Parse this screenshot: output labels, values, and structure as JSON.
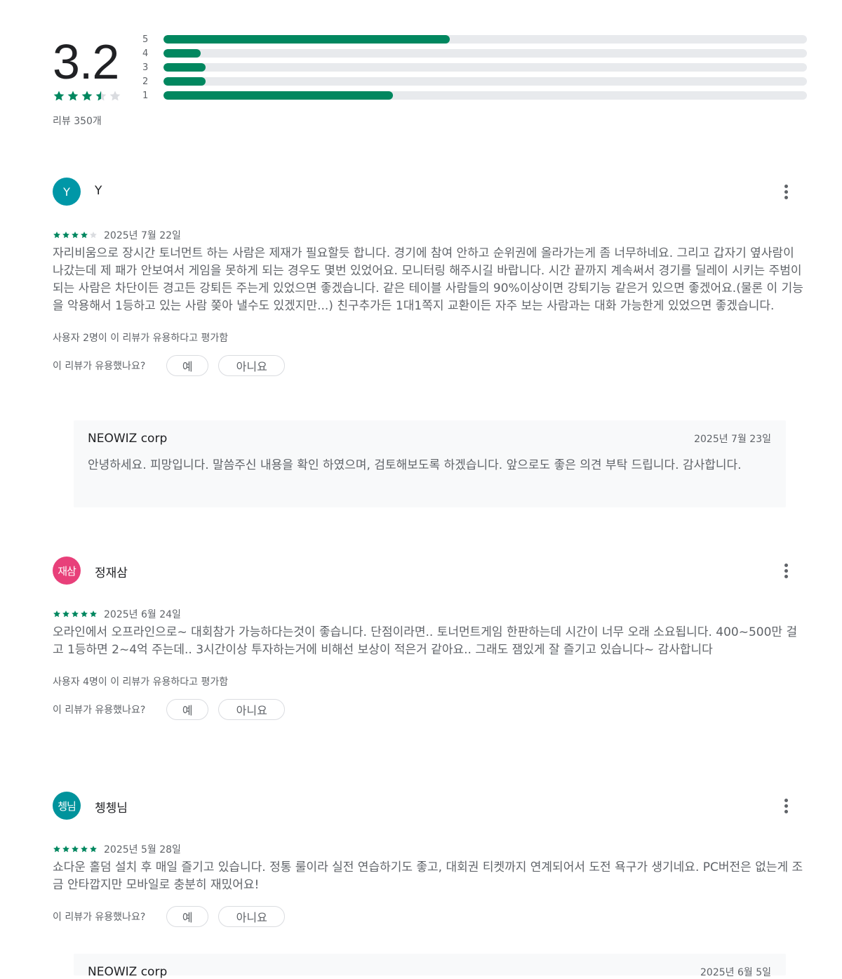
{
  "summary": {
    "score": "3.2",
    "rating": 3.5,
    "review_count": "리뷰 350개",
    "bars": [
      {
        "label": "5",
        "fraction": 0.445
      },
      {
        "label": "4",
        "fraction": 0.058
      },
      {
        "label": "3",
        "fraction": 0.065
      },
      {
        "label": "2",
        "fraction": 0.065
      },
      {
        "label": "1",
        "fraction": 0.357
      }
    ]
  },
  "colors": {
    "star_filled": "#01875f",
    "star_empty": "#dadce0",
    "bar_fill": "#01875f",
    "bar_track": "#e8eaed"
  },
  "helpful_question": "이 리뷰가 유용했나요?",
  "yes_label": "예",
  "no_label": "아니요",
  "reviews": [
    {
      "avatar_text": "Y",
      "avatar_color": "#0097a7",
      "author": "Y",
      "rating": 4,
      "date": "2025년 7월 22일",
      "text": "자리비움으로 장시간 토너먼트 하는 사람은 제재가 필요할듯 합니다. 경기에 참여 안하고 순위권에 올라가는게 좀 너무하네요. 그리고 갑자기 옆사람이 나갔는데 제 패가 안보여서 게임을 못하게 되는 경우도 몇번 있었어요. 모니터링 해주시길 바랍니다. 시간 끝까지 계속써서 경기를 딜레이 시키는 주범이 되는 사람은 차단이든 경고든 강퇴든 주는게 있었으면 좋겠습니다. 같은 테이블 사람들의 90%이상이면 강퇴기능 같은거 있으면 좋겠어요.(물론 이 기능을 악용해서 1등하고 있는 사람 쫒아 낼수도 있겠지만...) 친구추가든 1대1쪽지 교환이든 자주 보는 사람과는 대화 가능한게 있었으면 좋겠습니다.",
      "helpful_count": "사용자 2명이 이 리뷰가 유용하다고 평가함",
      "reply": {
        "name": "NEOWIZ corp",
        "date": "2025년 7월 23일",
        "text": "안녕하세요. 피망입니다. 말씀주신 내용을 확인 하였으며, 검토해보도록 하겠습니다. 앞으로도 좋은 의견 부탁 드립니다. 감사합니다."
      }
    },
    {
      "avatar_text": "재삼",
      "avatar_color": "#e8407a",
      "author": "정재삼",
      "rating": 5,
      "date": "2025년 6월 24일",
      "text": "오라인에서 오프라인으로~ 대회참가 가능하다는것이 좋습니다. 단점이라면.. 토너먼트게임 한판하는데 시간이 너무 오래 소요됩니다. 400~500만 걸고 1등하면 2~4억 주는데.. 3시간이상 투자하는거에 비해선 보상이 적은거 같아요.. 그래도 잼있게 잘 즐기고 있습니다~ 감사합니다",
      "helpful_count": "사용자 4명이 이 리뷰가 유용하다고 평가함"
    },
    {
      "avatar_text": "쳉님",
      "avatar_color": "#00939c",
      "author": "쳉쳉님",
      "rating": 5,
      "date": "2025년 5월 28일",
      "text": "쇼다운 홀덤 설치 후 매일 즐기고 있습니다. 정통 룰이라 실전 연습하기도 좋고, 대회권 티켓까지 연계되어서 도전 욕구가 생기네요. PC버전은 없는게 조금 안타깝지만 모바일로 충분히 재밌어요!",
      "reply": {
        "name": "NEOWIZ corp",
        "date": "2025년 6월 5일"
      }
    }
  ]
}
